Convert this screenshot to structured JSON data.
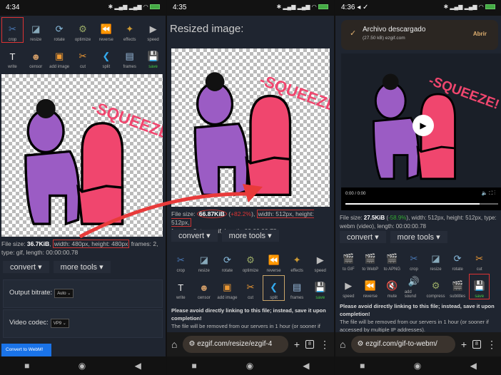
{
  "panel1": {
    "time": "4:34",
    "tools_row1": [
      "crop",
      "resize",
      "rotate",
      "optimize",
      "reverse",
      "effects",
      "speed"
    ],
    "tools_row2": [
      "write",
      "censor",
      "add image",
      "cut",
      "split",
      "frames",
      "save"
    ],
    "file_size_label": "File size: ",
    "file_size": "36.7KiB",
    "dims": "width: 480px, height: 480px",
    "rest": " frames: 2, type: gif, length: 00:00:00.78",
    "convert": "convert ▾",
    "more_tools": "more tools ▾",
    "bitrate_label": "Output bitrate:",
    "bitrate_value": "Auto",
    "codec_label": "Video codec:",
    "codec_value": "VP9",
    "convert_button": "Convert to WebM!"
  },
  "panel2": {
    "time": "4:35",
    "heading": "Resized image:",
    "file_size_label": "File size: ",
    "file_size": "66.87KiB",
    "change": "+82.2%",
    "dims": "width: 512px, height: 512px,",
    "rest": "frames: 2, type: gif, length: 00:00:00.78",
    "convert": "convert ▾",
    "more_tools": "more tools ▾",
    "tools_row1": [
      "crop",
      "resize",
      "rotate",
      "optimize",
      "reverse",
      "effects",
      "speed"
    ],
    "tools_row2": [
      "write",
      "censor",
      "add image",
      "cut",
      "split",
      "frames",
      "save"
    ],
    "notice_bold": "Please avoid directly linking to this file; instead, save it upon completion!",
    "notice": "The file will be removed from our servers in 1 hour (or sooner if",
    "url": "ezgif.com/resize/ezgif-4",
    "tab_count": "8"
  },
  "panel3": {
    "time": "4:36",
    "download_title": "Archivo descargado",
    "download_sub": "(27.50 kB) ezgif.com",
    "open": "Abrir",
    "video_time": "0:00 / 0:00",
    "video_progress": 0.88,
    "file_size_label": "File size: ",
    "file_size": "27.5KiB",
    "change": "-58.9%",
    "rest": ", width: 512px, height: 512px, type: webm (video), length: 00:00:00.78",
    "convert": "convert ▾",
    "more_tools": "more tools ▾",
    "tools_row1": [
      "to GIF",
      "to WebP",
      "to APNG",
      "crop",
      "resize",
      "rotate",
      "cut"
    ],
    "tools_row2": [
      "speed",
      "reverse",
      "mute",
      "add sound",
      "compress",
      "subtitles",
      "save"
    ],
    "notice_bold": "Please avoid directly linking to this file; instead, save it upon completion!",
    "notice": "The file will be removed from our servers in 1 hour (or sooner if accessed by multiple IP addresses).",
    "url": "ezgif.com/gif-to-webm/",
    "tab_count": "8"
  },
  "sticker_text": "-SQUEEZE!",
  "colors": {
    "highlight": "#d33333",
    "arrow": "#e83a3a",
    "purple": "#9b5cc4",
    "pink": "#f0466e",
    "bg": "#1f2530"
  }
}
